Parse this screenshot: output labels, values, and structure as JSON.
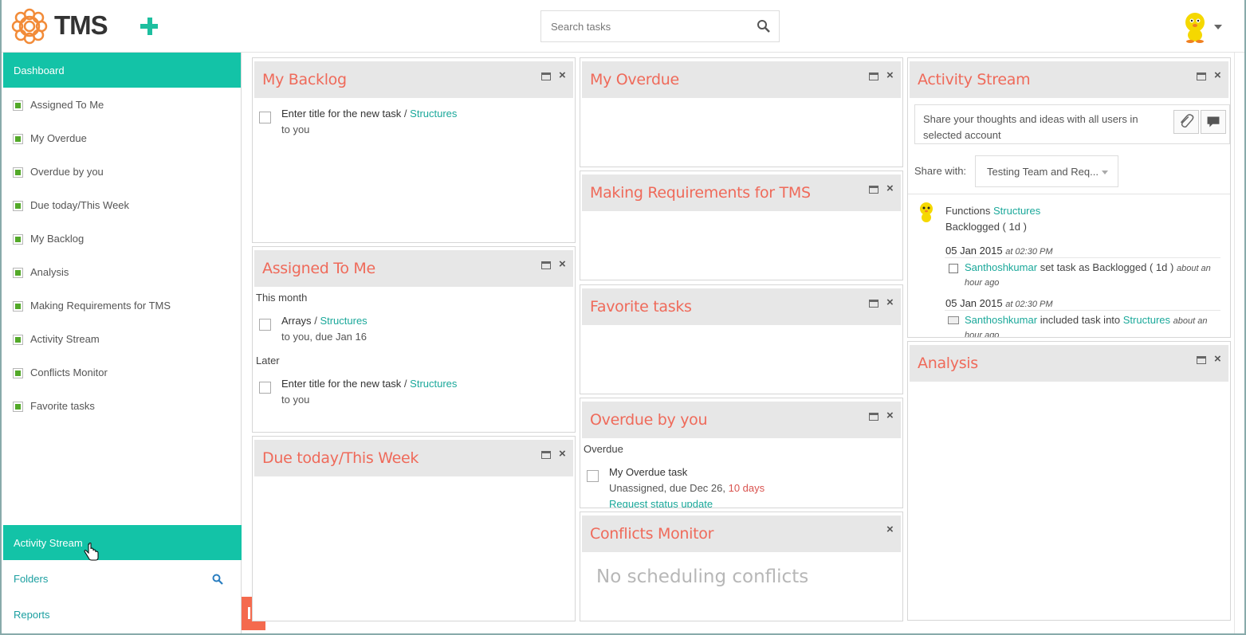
{
  "app": {
    "name": "TMS",
    "search_placeholder": "Search tasks"
  },
  "sidebar": {
    "header": "Dashboard",
    "items": [
      {
        "label": "Assigned To Me"
      },
      {
        "label": "My Overdue"
      },
      {
        "label": "Overdue by you"
      },
      {
        "label": "Due today/This Week"
      },
      {
        "label": "My Backlog"
      },
      {
        "label": "Analysis"
      },
      {
        "label": "Making Requirements for TMS"
      },
      {
        "label": "Activity Stream"
      },
      {
        "label": "Conflicts Monitor"
      },
      {
        "label": "Favorite tasks"
      }
    ],
    "active": "Activity Stream",
    "folders": "Folders",
    "reports": "Reports"
  },
  "widgets": {
    "my_backlog": {
      "title": "My Backlog",
      "task_title": "Enter title for the new task",
      "sep": "/",
      "task_project": "Structures",
      "task_sub": "to you"
    },
    "assigned": {
      "title": "Assigned To Me",
      "group1": "This month",
      "t1_title": "Arrays",
      "t1_project": "Structures",
      "t1_sub": "to you, due Jan 16",
      "group2": "Later",
      "t2_title": "Enter title for the new task",
      "t2_project": "Structures",
      "t2_sub": "to you"
    },
    "due_today": {
      "title": "Due today/This Week"
    },
    "my_overdue": {
      "title": "My Overdue"
    },
    "making_req": {
      "title": "Making Requirements for TMS"
    },
    "favorite": {
      "title": "Favorite tasks"
    },
    "overdue_by_you": {
      "title": "Overdue by you",
      "group": "Overdue",
      "task_title": "My Overdue task",
      "task_sub": "Unassigned, due Dec 26,",
      "task_overdue": "10 days",
      "task_link": "Request status update"
    },
    "conflicts": {
      "title": "Conflicts Monitor",
      "empty": "No scheduling conflicts"
    },
    "activity": {
      "title": "Activity Stream",
      "share_placeholder": "Share your thoughts and ideas with all users in selected account",
      "share_with_label": "Share with:",
      "share_with_value": "Testing Team and Req...",
      "entry_task": "Functions",
      "entry_project": "Structures",
      "entry_status": "Backlogged ( 1d )",
      "ev1_date": "05 Jan 2015",
      "ev1_time": "at 02:30 PM",
      "ev1_user": "Santhoshkumar",
      "ev1_text": "set task as Backlogged ( 1d )",
      "ev1_ago": "about an",
      "ev1_ago2": "hour ago",
      "ev2_date": "05 Jan 2015",
      "ev2_time": "at 02:30 PM",
      "ev2_user": "Santhoshkumar",
      "ev2_text": "included task into",
      "ev2_project": "Structures",
      "ev2_ago": "about an",
      "ev2_ago2": "hour ago"
    },
    "analysis": {
      "title": "Analysis"
    }
  },
  "colors": {
    "accent": "#13c3a7",
    "title": "#ef6a5a",
    "link": "#1aa89a",
    "collapse": "#f46a4e"
  }
}
